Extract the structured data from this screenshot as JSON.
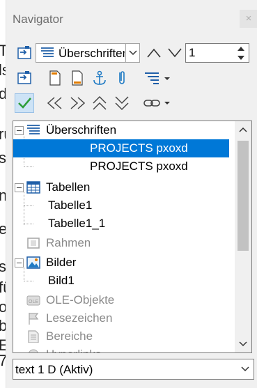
{
  "background_fragments": [
    "Ts",
    "ls",
    "d",
    "ru",
    "s",
    "n",
    "e",
    "s",
    "fü",
    "o",
    "b",
    "E",
    "7"
  ],
  "panel": {
    "title": "Navigator",
    "close_glyph": "×"
  },
  "toolbar": {
    "category_select": {
      "value": "Überschriften"
    },
    "page_spin": {
      "value": "1"
    },
    "icons": [
      "toggle-navigation-icon",
      "heading-list-icon",
      "previous-icon",
      "next-icon",
      "drag-mode-icon",
      "header-icon",
      "footer-icon",
      "anchor-icon",
      "reminder-icon",
      "outline-level-icon",
      "content-view-icon",
      "promote-chapter-icon",
      "demote-chapter-icon",
      "promote-level-icon",
      "demote-level-icon",
      "hyperlink-icon"
    ]
  },
  "tree": {
    "items": [
      {
        "label": "Überschriften",
        "kind": "category",
        "icon": "headings-icon"
      },
      {
        "label": "PROJECTS pxoxd",
        "kind": "child",
        "selected": true
      },
      {
        "label": "PROJECTS pxoxd",
        "kind": "child"
      },
      {
        "label": "Tabellen",
        "kind": "category",
        "icon": "table-icon"
      },
      {
        "label": "Tabelle1",
        "kind": "child"
      },
      {
        "label": "Tabelle1_1",
        "kind": "child"
      },
      {
        "label": "Rahmen",
        "kind": "category",
        "icon": "frame-icon",
        "disabled": true
      },
      {
        "label": "Bilder",
        "kind": "category",
        "icon": "image-icon"
      },
      {
        "label": "Bild1",
        "kind": "child"
      },
      {
        "label": "OLE-Objekte",
        "kind": "category",
        "icon": "ole-icon",
        "disabled": true
      },
      {
        "label": "Lesezeichen",
        "kind": "category",
        "icon": "bookmark-icon",
        "disabled": true
      },
      {
        "label": "Bereiche",
        "kind": "category",
        "icon": "section-icon",
        "disabled": true
      },
      {
        "label": "Hyperlinks",
        "kind": "category",
        "icon": "hyperlink-icon",
        "disabled": true
      }
    ]
  },
  "document_select": {
    "value": "text 1 D (Aktiv)"
  },
  "colors": {
    "selection": "#0078d7",
    "accent_green": "#2e9e3b",
    "icon_blue": "#1f5fa8"
  }
}
